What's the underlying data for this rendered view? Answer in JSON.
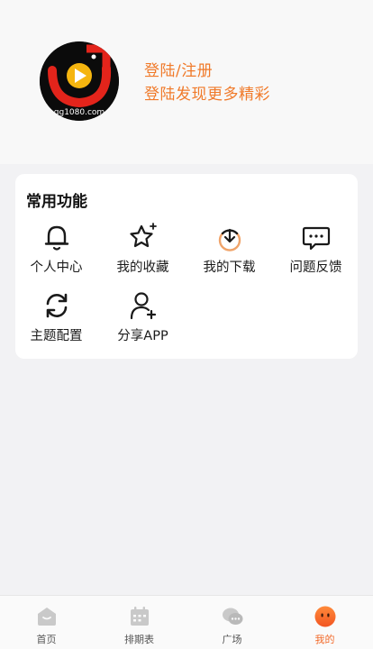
{
  "profile": {
    "avatar_text": "gg1080.com",
    "login_label": "登陆/注册",
    "login_subtitle": "登陆发现更多精彩"
  },
  "common_functions": {
    "title": "常用功能",
    "items": [
      {
        "label": "个人中心",
        "icon": "bell-icon"
      },
      {
        "label": "我的收藏",
        "icon": "star-icon"
      },
      {
        "label": "我的下载",
        "icon": "download-icon"
      },
      {
        "label": "问题反馈",
        "icon": "message-icon"
      },
      {
        "label": "主题配置",
        "icon": "refresh-icon"
      },
      {
        "label": "分享APP",
        "icon": "add-user-icon"
      }
    ]
  },
  "tabbar": {
    "active_color": "#f26a2a",
    "tabs": [
      {
        "label": "首页",
        "icon": "home-icon"
      },
      {
        "label": "排期表",
        "icon": "calendar-icon"
      },
      {
        "label": "广场",
        "icon": "chat-icon"
      },
      {
        "label": "我的",
        "icon": "face-icon",
        "active": true
      }
    ]
  }
}
